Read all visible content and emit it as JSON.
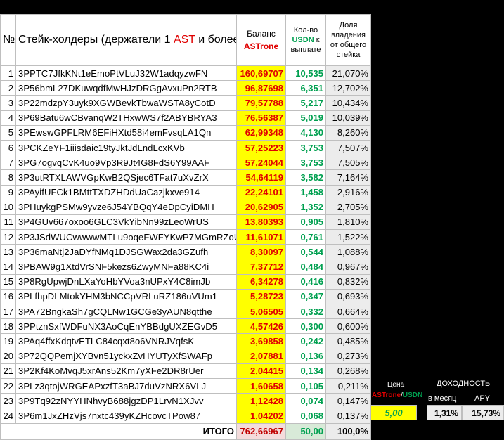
{
  "header": {
    "num": "№",
    "title_pre": "Стейк-холдеры (держатели 1 ",
    "title_ast": "AST",
    "title_post": " и более)",
    "balance_line1": "Баланс",
    "balance_line2": "ASTrone",
    "usdn_line1": "Кол-во",
    "usdn_line2": "USDN",
    "usdn_line3": " к выплате",
    "share": "Доля владения от общего стейка"
  },
  "rows": [
    {
      "n": "1",
      "address": "3PPTC7JfkKNt1eEmoPtVLuJ32W1adqyzwFN",
      "balance": "160,69707",
      "usdn": "10,535",
      "share": "21,070%"
    },
    {
      "n": "2",
      "address": "3P56bmL27DKuwqdfMwHJzDRGgAvxuPn2RTB",
      "balance": "96,87698",
      "usdn": "6,351",
      "share": "12,702%"
    },
    {
      "n": "3",
      "address": "3P22mdzpY3uyk9XGWBevkTbwaWSTA8yCotD",
      "balance": "79,57788",
      "usdn": "5,217",
      "share": "10,434%"
    },
    {
      "n": "4",
      "address": "3P69Batu6wCBvanqW2THxwWS7f2ABYBRYA3",
      "balance": "76,56387",
      "usdn": "5,019",
      "share": "10,039%"
    },
    {
      "n": "5",
      "address": "3PEwswGPFLRM6EFiHXtd58i4emFvsqLA1Qn",
      "balance": "62,99348",
      "usdn": "4,130",
      "share": "8,260%"
    },
    {
      "n": "6",
      "address": "3PCKZeYF1iiisdaic19tyJktJdLndLcxKVb",
      "balance": "57,25223",
      "usdn": "3,753",
      "share": "7,507%"
    },
    {
      "n": "7",
      "address": "3PG7ogvqCvK4uo9Vp3R9Jt4G8FdS6Y99AAF",
      "balance": "57,24044",
      "usdn": "3,753",
      "share": "7,505%"
    },
    {
      "n": "8",
      "address": "3P3utRTXLAWVGpKwB2QSjec6TFat7uXvZrX",
      "balance": "54,64119",
      "usdn": "3,582",
      "share": "7,164%"
    },
    {
      "n": "9",
      "address": "3PAyifUFCk1BMttTXDZHDdUaCazjkxve914",
      "balance": "22,24101",
      "usdn": "1,458",
      "share": "2,916%"
    },
    {
      "n": "10",
      "address": "3PHuykgPSMw9yvze6J54YBQqY4eDpCyiDMH",
      "balance": "20,62905",
      "usdn": "1,352",
      "share": "2,705%"
    },
    {
      "n": "11",
      "address": "3P4GUv667oxoo6GLC3VkYibNn99zLeoWrUS",
      "balance": "13,80393",
      "usdn": "0,905",
      "share": "1,810%"
    },
    {
      "n": "12",
      "address": "3P3JSdWUCwwwwMTLu9oqeFWFYKwP7MGmRZoU",
      "balance": "11,61071",
      "usdn": "0,761",
      "share": "1,522%"
    },
    {
      "n": "13",
      "address": "3P36maNtj2JaDYfNMq1DJSGWax2da3GZufh",
      "balance": "8,30097",
      "usdn": "0,544",
      "share": "1,088%"
    },
    {
      "n": "14",
      "address": "3PBAW9g1XtdVrSNF5kezs6ZwyMNFa88KC4i",
      "balance": "7,37712",
      "usdn": "0,484",
      "share": "0,967%"
    },
    {
      "n": "15",
      "address": "3P8RgUpwjDnLXaYoHbYVoa3nUPxY4C8imJb",
      "balance": "6,34278",
      "usdn": "0,416",
      "share": "0,832%"
    },
    {
      "n": "16",
      "address": "3PLfhpDLMtokYHM3bNCCpVRLuRZ186uVUm1",
      "balance": "5,28723",
      "usdn": "0,347",
      "share": "0,693%"
    },
    {
      "n": "17",
      "address": "3PA72BngkaSh7gCQLNw1GCGe3yAUN8qtthe",
      "balance": "5,06505",
      "usdn": "0,332",
      "share": "0,664%"
    },
    {
      "n": "18",
      "address": "3PPtznSxfWDFuNX3AoCqEnYBBdgUXZEGvD5",
      "balance": "4,57426",
      "usdn": "0,300",
      "share": "0,600%"
    },
    {
      "n": "19",
      "address": "3PAq4ffxKdqtvETLC84cqxt8o6VNRJVqfsK",
      "balance": "3,69858",
      "usdn": "0,242",
      "share": "0,485%"
    },
    {
      "n": "20",
      "address": "3P72QQPemjXYBvn51yckxZvHYUTyXfSWAFp",
      "balance": "2,07881",
      "usdn": "0,136",
      "share": "0,273%"
    },
    {
      "n": "21",
      "address": "3P2Kf4KoMvqJ5xrAns52Km7yXFe2DR8rUer",
      "balance": "2,04415",
      "usdn": "0,134",
      "share": "0,268%"
    },
    {
      "n": "22",
      "address": "3PLz3qtojWRGEAPxzfT3aBJ7duVzNRX6VLJ",
      "balance": "1,60658",
      "usdn": "0,105",
      "share": "0,211%"
    },
    {
      "n": "23",
      "address": "3P9Tq92zNYYHNhvyB688jgzDP1LrvN1XJvv",
      "balance": "1,12428",
      "usdn": "0,074",
      "share": "0,147%"
    },
    {
      "n": "24",
      "address": "3P6m1JxZHzVjs7nxtc439yKZHcovcTPow87",
      "balance": "1,04202",
      "usdn": "0,068",
      "share": "0,137%"
    }
  ],
  "total": {
    "label": "ИТОГО",
    "balance": "762,66967",
    "usdn": "50,00",
    "share": "100,0%"
  },
  "price": {
    "label": "Цена",
    "pair_a": "ASTrone",
    "sep": "/",
    "pair_b": "USDN",
    "value": "5,00"
  },
  "yield": {
    "label": "ДОХОДНОСТЬ",
    "monthly_label": "в месяц",
    "monthly": "1,31%",
    "apy_label": "APY",
    "apy": "15,73%"
  }
}
